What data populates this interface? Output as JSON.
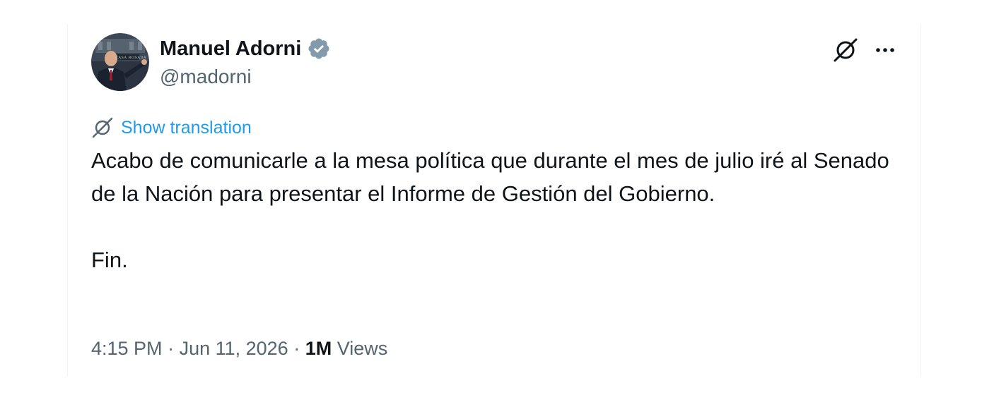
{
  "author": {
    "name": "Manuel Adorni",
    "handle": "@madorni",
    "verified": true,
    "avatar_icon": "avatar-photo",
    "avatar_sign_text": "CASA ROSADA"
  },
  "actions": {
    "grok_icon": "grok-icon",
    "more_icon": "more-dots-icon",
    "more_label": "···"
  },
  "translation": {
    "icon": "globe-icon",
    "label": "Show translation"
  },
  "tweet": {
    "text_paragraph_1": "Acabo de comunicarle a la mesa política que durante el mes de julio iré al Senado de la Nación para presentar el Informe de Gestión del Gobierno.",
    "text_paragraph_2": "Fin."
  },
  "meta": {
    "time": "4:15 PM",
    "separator": " · ",
    "date": "Jun 11, 2026",
    "views_count": "1M",
    "views_label": "Views"
  },
  "colors": {
    "link": "#1d9bf0",
    "secondary_text": "#536471",
    "primary_text": "#0f1419",
    "verified_badge": "#829aab",
    "border": "#eff3f4"
  }
}
